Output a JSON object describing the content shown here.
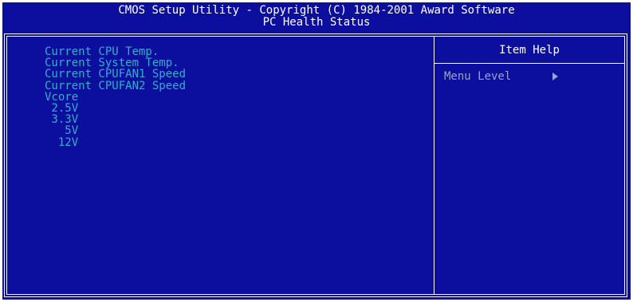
{
  "header": {
    "title": "CMOS Setup Utility - Copyright (C) 1984-2001 Award Software",
    "subtitle": "PC Health Status"
  },
  "main": {
    "items": [
      "Current CPU Temp.",
      "Current System Temp.",
      "Current CPUFAN1 Speed",
      "Current CPUFAN2 Speed",
      "Vcore",
      " 2.5V",
      " 3.3V",
      "   5V",
      "  12V"
    ]
  },
  "help": {
    "title": "Item Help",
    "menu_level_label": "Menu Level"
  },
  "colors": {
    "background": "#0c0f9e",
    "item_text": "#2fb0c8",
    "help_text": "#9aa3c8",
    "title_text": "#ffffff"
  }
}
